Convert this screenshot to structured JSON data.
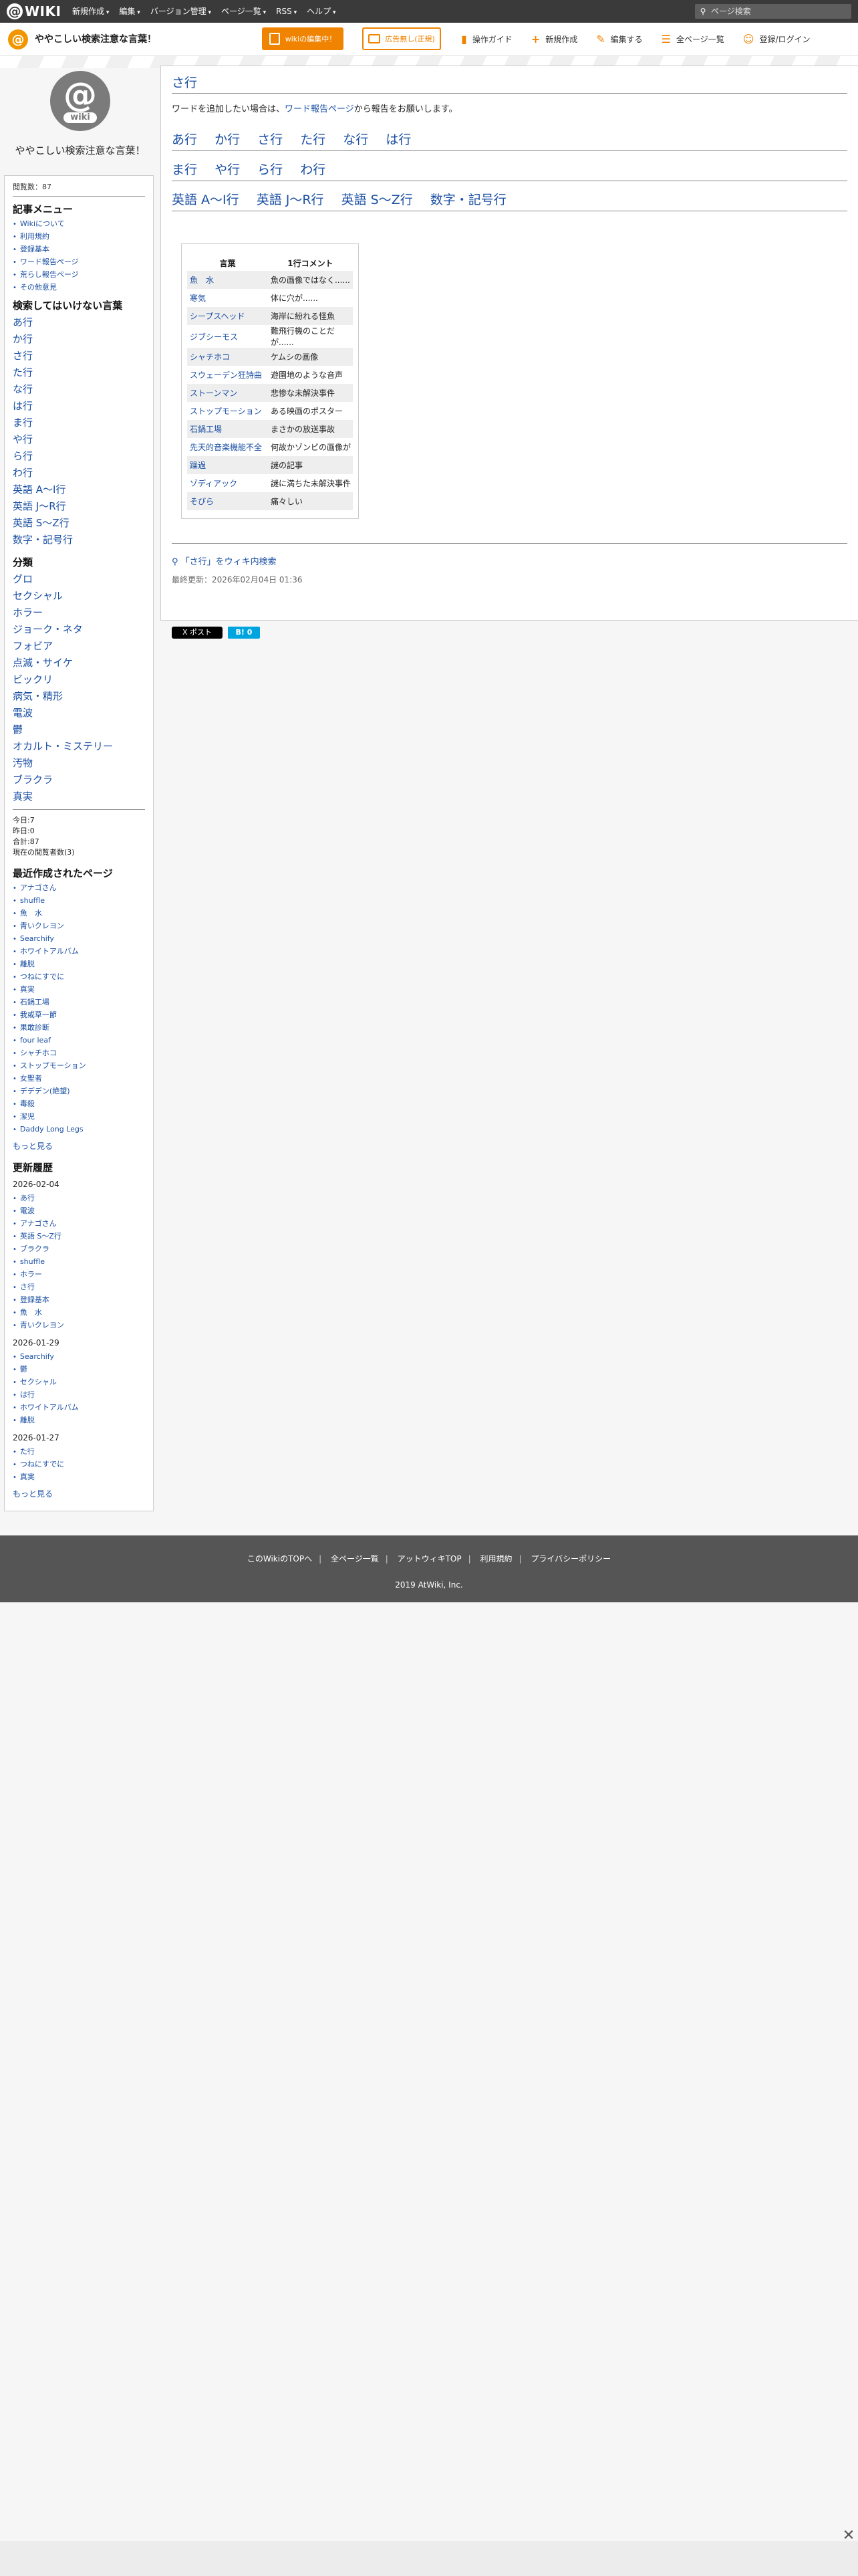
{
  "topbar": {
    "logo_text": "WIKI",
    "menu": [
      "新規作成",
      "編集",
      "バージョン管理",
      "ページ一覧",
      "RSS",
      "ヘルプ"
    ],
    "search_placeholder": "ページ検索"
  },
  "subbar": {
    "site_title": "ややこしい検索注意な言葉！",
    "edit_button": "wikiの編集中！",
    "ad_button": "広告無し(正規)",
    "links": [
      {
        "icon": "guide-icon",
        "label": "操作ガイド"
      },
      {
        "icon": "plus-icon",
        "label": "新規作成"
      },
      {
        "icon": "pencil-icon",
        "label": "編集する"
      },
      {
        "icon": "page-list-icon",
        "label": "全ページ一覧"
      },
      {
        "icon": "user-icon",
        "label": "登録/ログイン"
      }
    ]
  },
  "sidebar": {
    "logo_small": "wiki",
    "site_name": "ややこしい検索注意な言葉！",
    "page_count": "閲覧数：87",
    "menu_title": "記事メニュー",
    "menu_items": [
      "Wikiについて",
      "利用規約",
      "登録基本",
      "ワード報告ページ",
      "荒らし報告ページ",
      "その他意見"
    ],
    "forbidden_title": "検索してはいけない言葉",
    "forbidden_items": [
      "あ行",
      "か行",
      "さ行",
      "た行",
      "な行",
      "は行",
      "ま行",
      "や行",
      "ら行",
      "わ行",
      "英語 A～I行",
      "英語 J～R行",
      "英語 S～Z行",
      "数字・記号行"
    ],
    "category_title": "分類",
    "category_items": [
      "グロ",
      "セクシャル",
      "ホラー",
      "ジョーク・ネタ",
      "フォビア",
      "点滅・サイケ",
      "ビックリ",
      "病気・精形",
      "電波",
      "鬱",
      "オカルト・ミステリー",
      "汚物",
      "ブラクラ",
      "真実"
    ],
    "stats": [
      "今日:7",
      "昨日:0",
      "合計:87",
      "現在の閲覧者数(3)"
    ],
    "recent_title": "最近作成されたページ",
    "recent_items": [
      "アナゴさん",
      "shuffle",
      "魚　水",
      "青いクレヨン",
      "Searchify",
      "ホワイトアルバム",
      "離脱",
      "つねにすでに",
      "真実",
      "石鍋工場",
      "我或草一節",
      "果敢診断",
      "four leaf",
      "シャチホコ",
      "ストップモーション",
      "女聖者",
      "デデデン(絶望)",
      "毒殺",
      "潔児",
      "Daddy Long Legs"
    ],
    "recent_more": "もっと見る",
    "history_title": "更新履歴",
    "history": [
      {
        "date": "2026-02-04",
        "items": [
          "あ行",
          "電波",
          "アナゴさん",
          "英語 S～Z行",
          "ブラクラ",
          "shuffle",
          "ホラー",
          "さ行",
          "登録基本",
          "魚　水",
          "青いクレヨン"
        ]
      },
      {
        "date": "2026-01-29",
        "items": [
          "Searchify",
          "鬱",
          "セクシャル",
          "は行",
          "ホワイトアルバム",
          "離脱"
        ]
      },
      {
        "date": "2026-01-27",
        "items": [
          "た行",
          "つねにすでに",
          "真実"
        ]
      }
    ],
    "history_more": "もっと見る"
  },
  "main": {
    "title": "さ行",
    "intro_prefix": "ワードを追加したい場合は、",
    "intro_link": "ワード報告ページ",
    "intro_suffix": "から報告をお願いします。",
    "row1": [
      "あ行",
      "か行",
      "さ行",
      "た行",
      "な行",
      "は行"
    ],
    "row2": [
      "ま行",
      "や行",
      "ら行",
      "わ行"
    ],
    "row3": [
      "英語 A～I行",
      "英語 J～R行",
      "英語 S～Z行",
      "数字・記号行"
    ],
    "table_headers": [
      "言葉",
      "1行コメント"
    ],
    "table_rows": [
      [
        "魚　水",
        "魚の画像ではなく......"
      ],
      [
        "寒気",
        "体に穴が......"
      ],
      [
        "シープスヘッド",
        "海岸に紛れる怪魚"
      ],
      [
        "ジブシーモス",
        "難飛行機のことだが......"
      ],
      [
        "シャチホコ",
        "ケムシの画像"
      ],
      [
        "スウェーデン狂詩曲",
        "遊園地のような音声"
      ],
      [
        "ストーンマン",
        "悲惨な未解決事件"
      ],
      [
        "ストップモーション",
        "ある映画のポスター"
      ],
      [
        "石鍋工場",
        "まさかの放送事故"
      ],
      [
        "先天的音楽機能不全",
        "何故かゾンビの画像が"
      ],
      [
        "躁過",
        "謎の記事"
      ],
      [
        "ゾディアック",
        "謎に満ちた未解決事件"
      ],
      [
        "そびら",
        "痛々しい"
      ]
    ],
    "search_link": "「さ行」をウィキ内検索",
    "updated": "最終更新：2026年02月04日 01:36",
    "tweet": "X ポスト",
    "hatena": "B! 0"
  },
  "footer": {
    "links": [
      "このWikiのTOPへ",
      "全ページ一覧",
      "アットウィキTOP",
      "利用規約",
      "プライバシーポリシー"
    ],
    "copyright": "2019 AtWiki, Inc."
  }
}
